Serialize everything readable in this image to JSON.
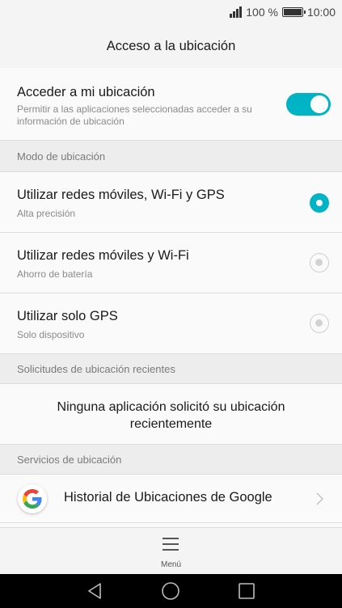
{
  "status_bar": {
    "battery_text": "100 %",
    "time": "10:00",
    "battery_level": 1.0
  },
  "header": {
    "title": "Acceso a la ubicación"
  },
  "location_access": {
    "title": "Acceder a mi ubicación",
    "subtitle": "Permitir a las aplicaciones seleccionadas acceder a su información de ubicación",
    "enabled": true,
    "accent_color": "#00b4c5"
  },
  "mode_section": {
    "header": "Modo de ubicación",
    "options": [
      {
        "title": "Utilizar redes móviles, Wi-Fi y GPS",
        "subtitle": "Alta precisión",
        "selected": true
      },
      {
        "title": "Utilizar redes móviles y Wi-Fi",
        "subtitle": "Ahorro de batería",
        "selected": false
      },
      {
        "title": "Utilizar solo GPS",
        "subtitle": "Solo dispositivo",
        "selected": false
      }
    ]
  },
  "recent_section": {
    "header": "Solicitudes de ubicación recientes",
    "empty_message": "Ninguna aplicación solicitó su ubicación recientemente"
  },
  "services_section": {
    "header": "Servicios de ubicación",
    "items": [
      {
        "label": "Historial de Ubicaciones de Google",
        "icon": "google-icon"
      }
    ]
  },
  "bottom_menu": {
    "label": "Menú",
    "icon": "menu-icon"
  },
  "nav_bar": {
    "buttons": [
      "back-icon",
      "home-icon",
      "recents-icon"
    ]
  }
}
